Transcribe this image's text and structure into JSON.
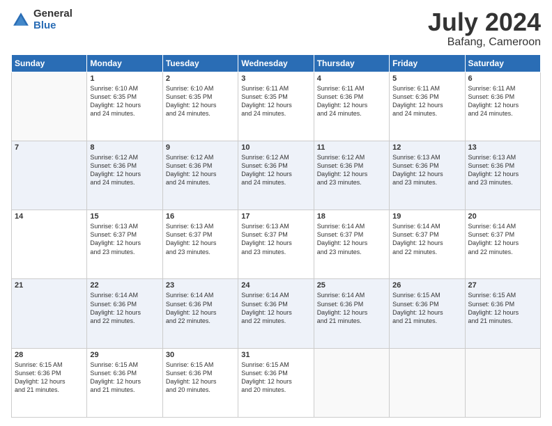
{
  "logo": {
    "general": "General",
    "blue": "Blue"
  },
  "title": {
    "month_year": "July 2024",
    "location": "Bafang, Cameroon"
  },
  "weekdays": [
    "Sunday",
    "Monday",
    "Tuesday",
    "Wednesday",
    "Thursday",
    "Friday",
    "Saturday"
  ],
  "weeks": [
    [
      {
        "day": "",
        "info": ""
      },
      {
        "day": "1",
        "info": "Sunrise: 6:10 AM\nSunset: 6:35 PM\nDaylight: 12 hours\nand 24 minutes."
      },
      {
        "day": "2",
        "info": "Sunrise: 6:10 AM\nSunset: 6:35 PM\nDaylight: 12 hours\nand 24 minutes."
      },
      {
        "day": "3",
        "info": "Sunrise: 6:11 AM\nSunset: 6:35 PM\nDaylight: 12 hours\nand 24 minutes."
      },
      {
        "day": "4",
        "info": "Sunrise: 6:11 AM\nSunset: 6:36 PM\nDaylight: 12 hours\nand 24 minutes."
      },
      {
        "day": "5",
        "info": "Sunrise: 6:11 AM\nSunset: 6:36 PM\nDaylight: 12 hours\nand 24 minutes."
      },
      {
        "day": "6",
        "info": "Sunrise: 6:11 AM\nSunset: 6:36 PM\nDaylight: 12 hours\nand 24 minutes."
      }
    ],
    [
      {
        "day": "7",
        "info": ""
      },
      {
        "day": "8",
        "info": "Sunrise: 6:12 AM\nSunset: 6:36 PM\nDaylight: 12 hours\nand 24 minutes."
      },
      {
        "day": "9",
        "info": "Sunrise: 6:12 AM\nSunset: 6:36 PM\nDaylight: 12 hours\nand 24 minutes."
      },
      {
        "day": "10",
        "info": "Sunrise: 6:12 AM\nSunset: 6:36 PM\nDaylight: 12 hours\nand 24 minutes."
      },
      {
        "day": "11",
        "info": "Sunrise: 6:12 AM\nSunset: 6:36 PM\nDaylight: 12 hours\nand 23 minutes."
      },
      {
        "day": "12",
        "info": "Sunrise: 6:13 AM\nSunset: 6:36 PM\nDaylight: 12 hours\nand 23 minutes."
      },
      {
        "day": "13",
        "info": "Sunrise: 6:13 AM\nSunset: 6:36 PM\nDaylight: 12 hours\nand 23 minutes."
      }
    ],
    [
      {
        "day": "14",
        "info": ""
      },
      {
        "day": "15",
        "info": "Sunrise: 6:13 AM\nSunset: 6:37 PM\nDaylight: 12 hours\nand 23 minutes."
      },
      {
        "day": "16",
        "info": "Sunrise: 6:13 AM\nSunset: 6:37 PM\nDaylight: 12 hours\nand 23 minutes."
      },
      {
        "day": "17",
        "info": "Sunrise: 6:13 AM\nSunset: 6:37 PM\nDaylight: 12 hours\nand 23 minutes."
      },
      {
        "day": "18",
        "info": "Sunrise: 6:14 AM\nSunset: 6:37 PM\nDaylight: 12 hours\nand 23 minutes."
      },
      {
        "day": "19",
        "info": "Sunrise: 6:14 AM\nSunset: 6:37 PM\nDaylight: 12 hours\nand 22 minutes."
      },
      {
        "day": "20",
        "info": "Sunrise: 6:14 AM\nSunset: 6:37 PM\nDaylight: 12 hours\nand 22 minutes."
      }
    ],
    [
      {
        "day": "21",
        "info": ""
      },
      {
        "day": "22",
        "info": "Sunrise: 6:14 AM\nSunset: 6:36 PM\nDaylight: 12 hours\nand 22 minutes."
      },
      {
        "day": "23",
        "info": "Sunrise: 6:14 AM\nSunset: 6:36 PM\nDaylight: 12 hours\nand 22 minutes."
      },
      {
        "day": "24",
        "info": "Sunrise: 6:14 AM\nSunset: 6:36 PM\nDaylight: 12 hours\nand 22 minutes."
      },
      {
        "day": "25",
        "info": "Sunrise: 6:14 AM\nSunset: 6:36 PM\nDaylight: 12 hours\nand 21 minutes."
      },
      {
        "day": "26",
        "info": "Sunrise: 6:15 AM\nSunset: 6:36 PM\nDaylight: 12 hours\nand 21 minutes."
      },
      {
        "day": "27",
        "info": "Sunrise: 6:15 AM\nSunset: 6:36 PM\nDaylight: 12 hours\nand 21 minutes."
      }
    ],
    [
      {
        "day": "28",
        "info": "Sunrise: 6:15 AM\nSunset: 6:36 PM\nDaylight: 12 hours\nand 21 minutes."
      },
      {
        "day": "29",
        "info": "Sunrise: 6:15 AM\nSunset: 6:36 PM\nDaylight: 12 hours\nand 21 minutes."
      },
      {
        "day": "30",
        "info": "Sunrise: 6:15 AM\nSunset: 6:36 PM\nDaylight: 12 hours\nand 20 minutes."
      },
      {
        "day": "31",
        "info": "Sunrise: 6:15 AM\nSunset: 6:36 PM\nDaylight: 12 hours\nand 20 minutes."
      },
      {
        "day": "",
        "info": ""
      },
      {
        "day": "",
        "info": ""
      },
      {
        "day": "",
        "info": ""
      }
    ]
  ]
}
